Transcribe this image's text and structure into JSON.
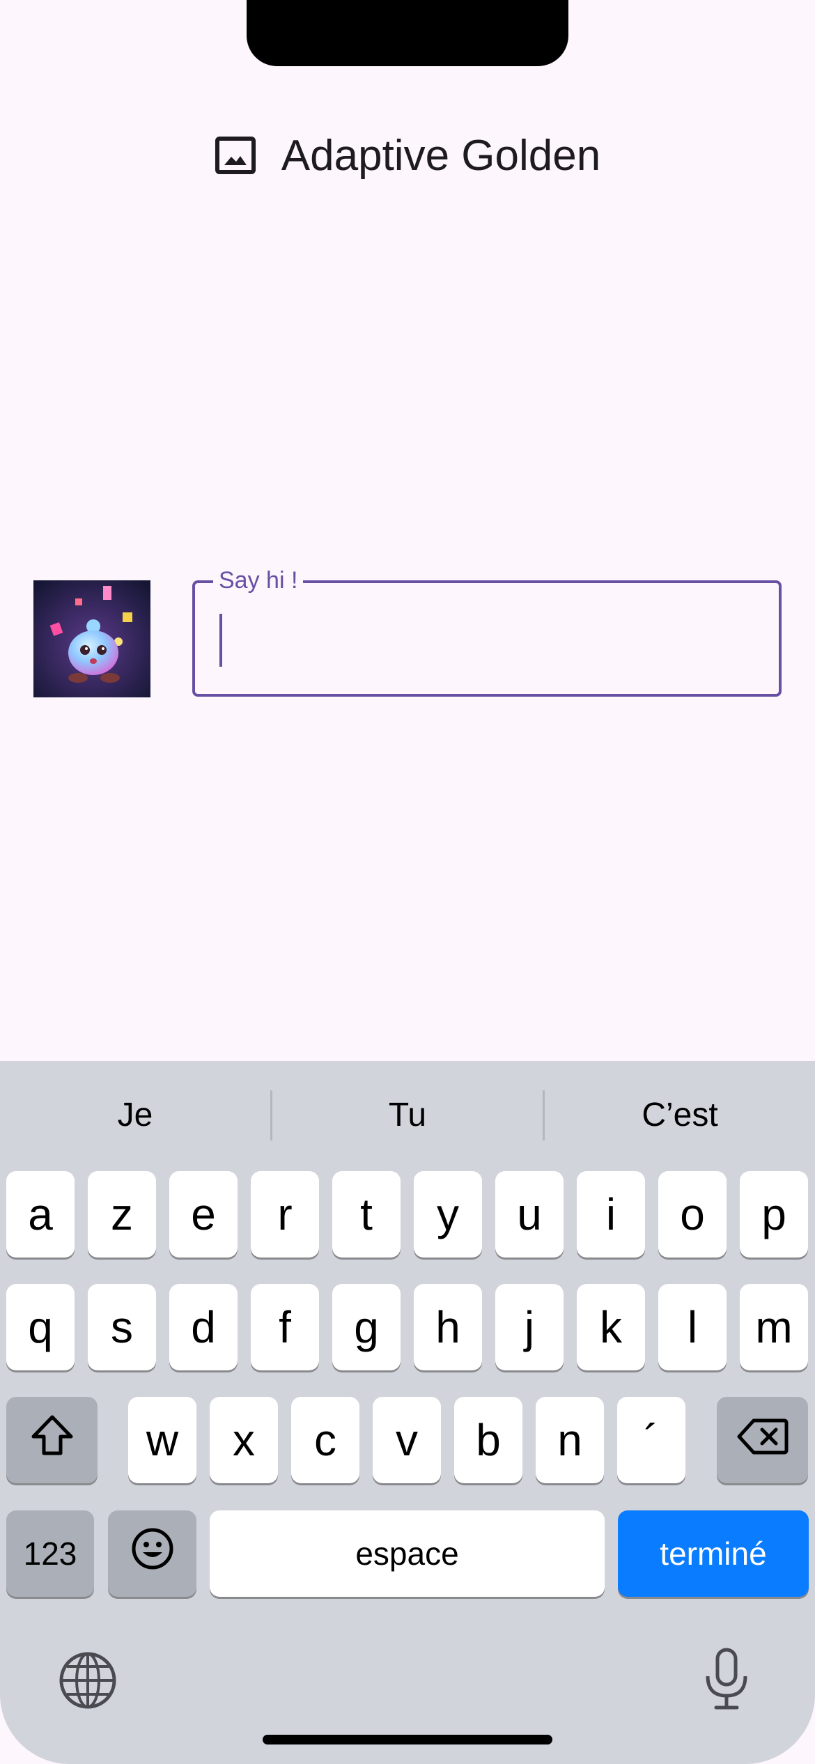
{
  "app": {
    "title": "Adaptive Golden",
    "title_icon": "image-icon"
  },
  "avatar": {
    "icon": "avatar-image"
  },
  "input": {
    "label": "Say hi !",
    "value": "",
    "accent": "#6750a4"
  },
  "keyboard": {
    "suggestions": [
      "Je",
      "Tu",
      "C’est"
    ],
    "rows": [
      [
        "a",
        "z",
        "e",
        "r",
        "t",
        "y",
        "u",
        "i",
        "o",
        "p"
      ],
      [
        "q",
        "s",
        "d",
        "f",
        "g",
        "h",
        "j",
        "k",
        "l",
        "m"
      ],
      [
        "w",
        "x",
        "c",
        "v",
        "b",
        "n",
        "´"
      ]
    ],
    "shift_icon": "shift-icon",
    "delete_icon": "backspace-icon",
    "numbers_label": "123",
    "emoji_icon": "emoji-icon",
    "space_label": "espace",
    "done_label": "terminé",
    "globe_icon": "globe-icon",
    "mic_icon": "microphone-icon",
    "done_color": "#0a7cff"
  }
}
